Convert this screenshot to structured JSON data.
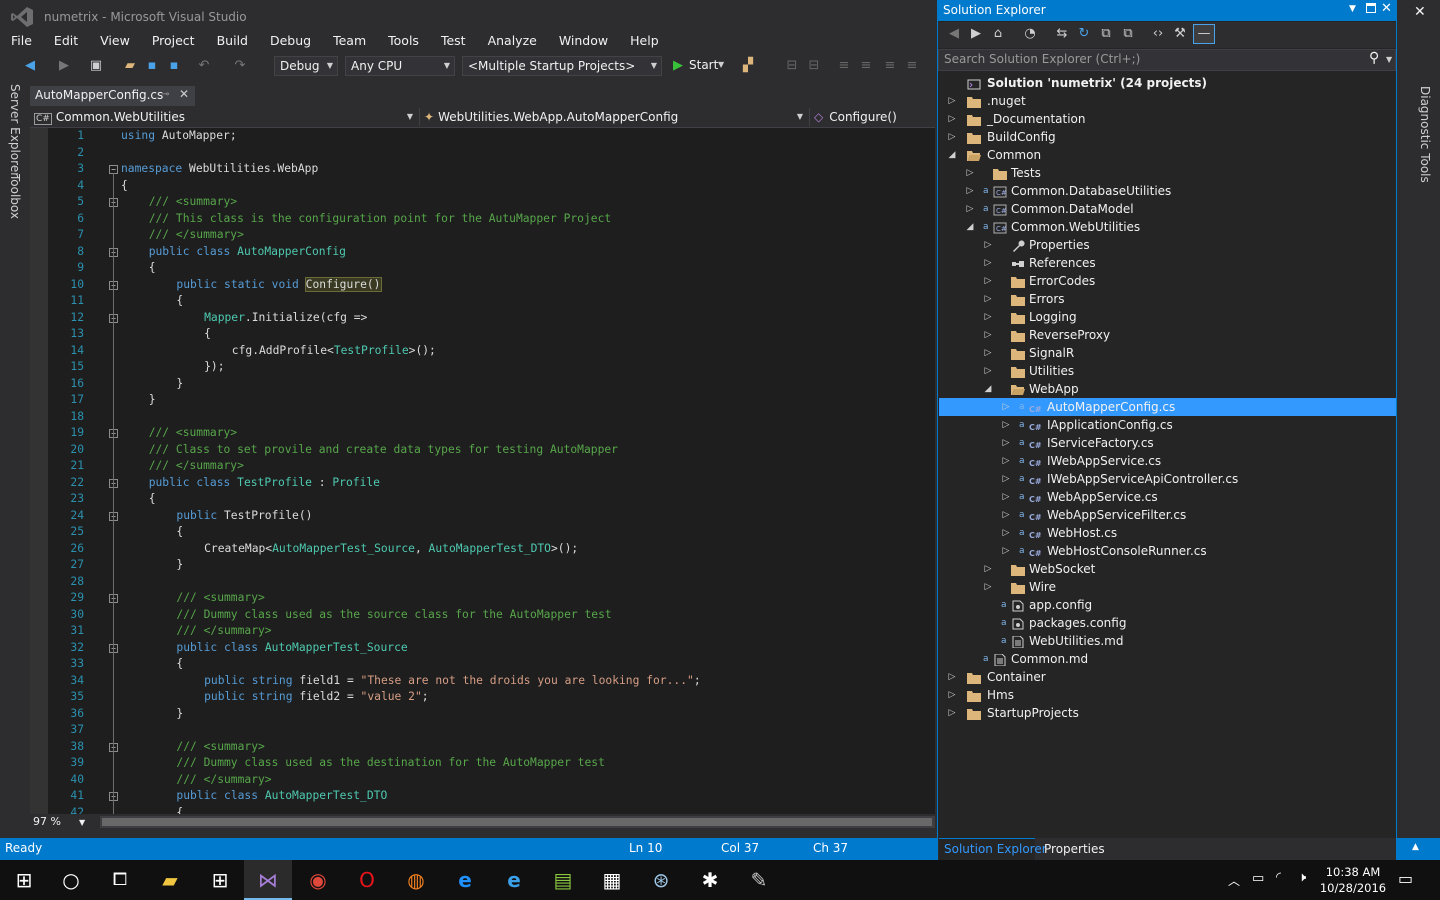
{
  "window": {
    "title": "numetrix - Microsoft Visual Studio",
    "close_glyph": "✕"
  },
  "menu": [
    "File",
    "Edit",
    "View",
    "Project",
    "Build",
    "Debug",
    "Team",
    "Tools",
    "Test",
    "Analyze",
    "Window",
    "Help"
  ],
  "toolbar": {
    "config": "Debug",
    "platform": "Any CPU",
    "startup": "<Multiple Startup Projects>",
    "start_label": "Start"
  },
  "left_rail": [
    "Server Explorer",
    "Toolbox"
  ],
  "right_rail": [
    "Diagnostic Tools"
  ],
  "editor": {
    "tab_label": "AutoMapperConfig.cs",
    "nav_project": "Common.WebUtilities",
    "nav_class": "WebUtilities.WebApp.AutoMapperConfig",
    "nav_member": "Configure()",
    "zoom": "97 %",
    "lines": [
      {
        "n": "1",
        "indent": 0,
        "tokens": [
          [
            "kw",
            "using"
          ],
          [
            "pl",
            " AutoMapper;"
          ]
        ]
      },
      {
        "n": "2",
        "indent": 0,
        "tokens": []
      },
      {
        "n": "3",
        "indent": 0,
        "fold": "−",
        "tokens": [
          [
            "kw",
            "namespace"
          ],
          [
            "pl",
            " WebUtilities.WebApp"
          ]
        ]
      },
      {
        "n": "4",
        "indent": 0,
        "tokens": [
          [
            "pl",
            "{"
          ]
        ]
      },
      {
        "n": "5",
        "indent": 1,
        "fold": "−",
        "tokens": [
          [
            "cm",
            "/// <summary>"
          ]
        ]
      },
      {
        "n": "6",
        "indent": 1,
        "tokens": [
          [
            "cm",
            "/// This class is the configuration point for the AutuMapper Project"
          ]
        ]
      },
      {
        "n": "7",
        "indent": 1,
        "tokens": [
          [
            "cm",
            "/// </summary>"
          ]
        ]
      },
      {
        "n": "8",
        "indent": 1,
        "fold": "−",
        "tokens": [
          [
            "kw",
            "public"
          ],
          [
            "pl",
            " "
          ],
          [
            "kw",
            "class"
          ],
          [
            "pl",
            " "
          ],
          [
            "ty",
            "AutoMapperConfig"
          ]
        ]
      },
      {
        "n": "9",
        "indent": 1,
        "tokens": [
          [
            "pl",
            "{"
          ]
        ]
      },
      {
        "n": "10",
        "indent": 2,
        "fold": "−",
        "tokens": [
          [
            "kw",
            "public"
          ],
          [
            "pl",
            " "
          ],
          [
            "kw",
            "static"
          ],
          [
            "pl",
            " "
          ],
          [
            "kw",
            "void"
          ],
          [
            "pl",
            " "
          ],
          [
            "hl",
            "Configure()"
          ]
        ]
      },
      {
        "n": "11",
        "indent": 2,
        "tokens": [
          [
            "pl",
            "{"
          ]
        ]
      },
      {
        "n": "12",
        "indent": 3,
        "fold": "−",
        "tokens": [
          [
            "ty",
            "Mapper"
          ],
          [
            "pl",
            ".Initialize(cfg =>"
          ]
        ]
      },
      {
        "n": "13",
        "indent": 3,
        "tokens": [
          [
            "pl",
            "{"
          ]
        ]
      },
      {
        "n": "14",
        "indent": 4,
        "tokens": [
          [
            "pl",
            "cfg.AddProfile<"
          ],
          [
            "ty",
            "TestProfile"
          ],
          [
            "pl",
            ">();"
          ]
        ]
      },
      {
        "n": "15",
        "indent": 3,
        "tokens": [
          [
            "pl",
            "});"
          ]
        ]
      },
      {
        "n": "16",
        "indent": 2,
        "tokens": [
          [
            "pl",
            "}"
          ]
        ]
      },
      {
        "n": "17",
        "indent": 1,
        "tokens": [
          [
            "pl",
            "}"
          ]
        ]
      },
      {
        "n": "18",
        "indent": 0,
        "tokens": []
      },
      {
        "n": "19",
        "indent": 1,
        "fold": "−",
        "tokens": [
          [
            "cm",
            "/// <summary>"
          ]
        ]
      },
      {
        "n": "20",
        "indent": 1,
        "tokens": [
          [
            "cm",
            "/// Class to set provile and create data types for testing AutoMapper"
          ]
        ]
      },
      {
        "n": "21",
        "indent": 1,
        "tokens": [
          [
            "cm",
            "/// </summary>"
          ]
        ]
      },
      {
        "n": "22",
        "indent": 1,
        "fold": "−",
        "tokens": [
          [
            "kw",
            "public"
          ],
          [
            "pl",
            " "
          ],
          [
            "kw",
            "class"
          ],
          [
            "pl",
            " "
          ],
          [
            "ty",
            "TestProfile"
          ],
          [
            "pl",
            " : "
          ],
          [
            "ty",
            "Profile"
          ]
        ]
      },
      {
        "n": "23",
        "indent": 1,
        "tokens": [
          [
            "pl",
            "{"
          ]
        ]
      },
      {
        "n": "24",
        "indent": 2,
        "fold": "−",
        "tokens": [
          [
            "kw",
            "public"
          ],
          [
            "pl",
            " TestProfile()"
          ]
        ]
      },
      {
        "n": "25",
        "indent": 2,
        "tokens": [
          [
            "pl",
            "{"
          ]
        ]
      },
      {
        "n": "26",
        "indent": 3,
        "tokens": [
          [
            "pl",
            "CreateMap<"
          ],
          [
            "ty",
            "AutoMapperTest_Source"
          ],
          [
            "pl",
            ", "
          ],
          [
            "ty",
            "AutoMapperTest_DTO"
          ],
          [
            "pl",
            ">();"
          ]
        ]
      },
      {
        "n": "27",
        "indent": 2,
        "tokens": [
          [
            "pl",
            "}"
          ]
        ]
      },
      {
        "n": "28",
        "indent": 0,
        "tokens": []
      },
      {
        "n": "29",
        "indent": 2,
        "fold": "−",
        "tokens": [
          [
            "cm",
            "/// <summary>"
          ]
        ]
      },
      {
        "n": "30",
        "indent": 2,
        "tokens": [
          [
            "cm",
            "/// Dummy class used as the source class for the AutoMapper test"
          ]
        ]
      },
      {
        "n": "31",
        "indent": 2,
        "tokens": [
          [
            "cm",
            "/// </summary>"
          ]
        ]
      },
      {
        "n": "32",
        "indent": 2,
        "fold": "−",
        "tokens": [
          [
            "kw",
            "public"
          ],
          [
            "pl",
            " "
          ],
          [
            "kw",
            "class"
          ],
          [
            "pl",
            " "
          ],
          [
            "ty",
            "AutoMapperTest_Source"
          ]
        ]
      },
      {
        "n": "33",
        "indent": 2,
        "tokens": [
          [
            "pl",
            "{"
          ]
        ]
      },
      {
        "n": "34",
        "indent": 3,
        "tokens": [
          [
            "kw",
            "public"
          ],
          [
            "pl",
            " "
          ],
          [
            "kw",
            "string"
          ],
          [
            "pl",
            " field1 = "
          ],
          [
            "st",
            "\"These are not the droids you are looking for...\""
          ],
          [
            "pl",
            ";"
          ]
        ]
      },
      {
        "n": "35",
        "indent": 3,
        "tokens": [
          [
            "kw",
            "public"
          ],
          [
            "pl",
            " "
          ],
          [
            "kw",
            "string"
          ],
          [
            "pl",
            " field2 = "
          ],
          [
            "st",
            "\"value 2\""
          ],
          [
            "pl",
            ";"
          ]
        ]
      },
      {
        "n": "36",
        "indent": 2,
        "tokens": [
          [
            "pl",
            "}"
          ]
        ]
      },
      {
        "n": "37",
        "indent": 0,
        "tokens": []
      },
      {
        "n": "38",
        "indent": 2,
        "fold": "−",
        "tokens": [
          [
            "cm",
            "/// <summary>"
          ]
        ]
      },
      {
        "n": "39",
        "indent": 2,
        "tokens": [
          [
            "cm",
            "/// Dummy class used as the destination for the AutoMapper test"
          ]
        ]
      },
      {
        "n": "40",
        "indent": 2,
        "tokens": [
          [
            "cm",
            "/// </summary>"
          ]
        ]
      },
      {
        "n": "41",
        "indent": 2,
        "fold": "−",
        "tokens": [
          [
            "kw",
            "public"
          ],
          [
            "pl",
            " "
          ],
          [
            "kw",
            "class"
          ],
          [
            "pl",
            " "
          ],
          [
            "ty",
            "AutoMapperTest_DTO"
          ]
        ]
      },
      {
        "n": "42",
        "indent": 2,
        "tokens": [
          [
            "pl",
            "{"
          ]
        ]
      }
    ]
  },
  "solution_explorer": {
    "title": "Solution Explorer",
    "search_placeholder": "Search Solution Explorer (Ctrl+;)",
    "bottom_tabs": [
      "Solution Explorer",
      "Properties"
    ],
    "items": [
      {
        "depth": 0,
        "arrow": "",
        "icon": "solution",
        "label": "Solution 'numetrix' (24 projects)",
        "bold": true
      },
      {
        "depth": 0,
        "arrow": "▷",
        "icon": "folder",
        "label": ".nuget"
      },
      {
        "depth": 0,
        "arrow": "▷",
        "icon": "folder",
        "label": "_Documentation"
      },
      {
        "depth": 0,
        "arrow": "▷",
        "icon": "folder",
        "label": "BuildConfig"
      },
      {
        "depth": 0,
        "arrow": "◢",
        "icon": "folder-open",
        "label": "Common"
      },
      {
        "depth": 1,
        "arrow": "▷",
        "icon": "folder",
        "label": "Tests"
      },
      {
        "depth": 1,
        "arrow": "▷",
        "icon": "csproj",
        "label": "Common.DatabaseUtilities"
      },
      {
        "depth": 1,
        "arrow": "▷",
        "icon": "csproj",
        "label": "Common.DataModel"
      },
      {
        "depth": 1,
        "arrow": "◢",
        "icon": "csproj",
        "label": "Common.WebUtilities"
      },
      {
        "depth": 2,
        "arrow": "▷",
        "icon": "wrench",
        "label": "Properties"
      },
      {
        "depth": 2,
        "arrow": "▷",
        "icon": "refs",
        "label": "References"
      },
      {
        "depth": 2,
        "arrow": "▷",
        "icon": "folder",
        "label": "ErrorCodes"
      },
      {
        "depth": 2,
        "arrow": "▷",
        "icon": "folder",
        "label": "Errors"
      },
      {
        "depth": 2,
        "arrow": "▷",
        "icon": "folder",
        "label": "Logging"
      },
      {
        "depth": 2,
        "arrow": "▷",
        "icon": "folder",
        "label": "ReverseProxy"
      },
      {
        "depth": 2,
        "arrow": "▷",
        "icon": "folder",
        "label": "SignalR"
      },
      {
        "depth": 2,
        "arrow": "▷",
        "icon": "folder",
        "label": "Utilities"
      },
      {
        "depth": 2,
        "arrow": "◢",
        "icon": "folder-open",
        "label": "WebApp"
      },
      {
        "depth": 3,
        "arrow": "▷",
        "icon": "csfile",
        "label": "AutoMapperConfig.cs",
        "selected": true
      },
      {
        "depth": 3,
        "arrow": "▷",
        "icon": "csfile",
        "label": "IApplicationConfig.cs"
      },
      {
        "depth": 3,
        "arrow": "▷",
        "icon": "csfile",
        "label": "IServiceFactory.cs"
      },
      {
        "depth": 3,
        "arrow": "▷",
        "icon": "csfile",
        "label": "IWebAppService.cs"
      },
      {
        "depth": 3,
        "arrow": "▷",
        "icon": "csfile",
        "label": "IWebAppServiceApiController.cs"
      },
      {
        "depth": 3,
        "arrow": "▷",
        "icon": "csfile",
        "label": "WebAppService.cs"
      },
      {
        "depth": 3,
        "arrow": "▷",
        "icon": "csfile",
        "label": "WebAppServiceFilter.cs"
      },
      {
        "depth": 3,
        "arrow": "▷",
        "icon": "csfile",
        "label": "WebHost.cs"
      },
      {
        "depth": 3,
        "arrow": "▷",
        "icon": "csfile",
        "label": "WebHostConsoleRunner.cs"
      },
      {
        "depth": 2,
        "arrow": "▷",
        "icon": "folder",
        "label": "WebSocket"
      },
      {
        "depth": 2,
        "arrow": "▷",
        "icon": "folder",
        "label": "Wire"
      },
      {
        "depth": 2,
        "arrow": "",
        "icon": "config",
        "label": "app.config"
      },
      {
        "depth": 2,
        "arrow": "",
        "icon": "config",
        "label": "packages.config"
      },
      {
        "depth": 2,
        "arrow": "",
        "icon": "doc",
        "label": "WebUtilities.md"
      },
      {
        "depth": 1,
        "arrow": "",
        "icon": "doc",
        "label": "Common.md"
      },
      {
        "depth": 0,
        "arrow": "▷",
        "icon": "folder",
        "label": "Container"
      },
      {
        "depth": 0,
        "arrow": "▷",
        "icon": "folder",
        "label": "Hms"
      },
      {
        "depth": 0,
        "arrow": "▷",
        "icon": "folder",
        "label": "StartupProjects"
      }
    ]
  },
  "status": {
    "state": "Ready",
    "ln": "Ln 10",
    "col": "Col 37",
    "ch": "Ch 37"
  },
  "taskbar": {
    "time": "10:38 AM",
    "date": "10/28/2016"
  },
  "colors": {
    "accent": "#007acc",
    "selection": "#3399ff",
    "keyword": "#569cd6",
    "type": "#4ec9b0",
    "comment": "#57a64a",
    "string": "#d69d85"
  }
}
